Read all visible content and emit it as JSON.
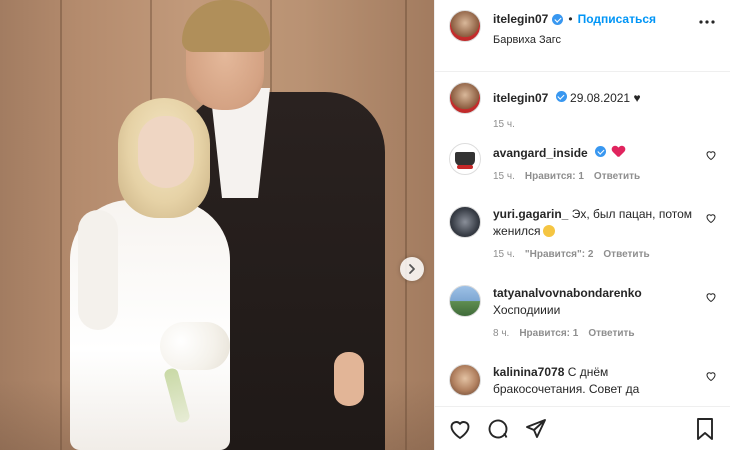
{
  "post": {
    "username": "itelegin07",
    "follow_label": "Подписаться",
    "separator": "•",
    "location": "Барвиха Загс"
  },
  "caption": {
    "username": "itelegin07",
    "text": "29.08.2021 ♥",
    "time": "15 ч."
  },
  "comments": [
    {
      "username": "avangard_inside",
      "text": "",
      "time": "15 ч.",
      "likes": "Нравится: 1",
      "reply": "Ответить",
      "avatar": "avangard-logo",
      "verified": true,
      "emoji": "heart"
    },
    {
      "username": "yuri.gagarin_",
      "text": "Эх, был пацан, потом женился",
      "time": "15 ч.",
      "likes": "\"Нравится\": 2",
      "reply": "Ответить",
      "avatar": "yuri-avatar",
      "emoji": "face-with-tears"
    },
    {
      "username": "tatyanalvovnabondarenko",
      "text": "Хосподииии",
      "time": "8 ч.",
      "likes": "Нравится: 1",
      "reply": "Ответить",
      "avatar": "tatyana-avatar"
    },
    {
      "username": "kalinina7078",
      "text": "С днём бракосочетания. Совет да",
      "time": "",
      "likes": "",
      "reply": "",
      "avatar": "kalinina-avatar"
    }
  ],
  "colors": {
    "accent": "#0095f6",
    "verified": "#3897f0",
    "heart": "#e0245e",
    "muted": "#8e8e8e",
    "text": "#262626"
  },
  "icons": {
    "more": "more-horizontal-icon",
    "like": "heart-icon",
    "comment": "comment-icon",
    "share": "paper-plane-icon",
    "save": "bookmark-icon",
    "next": "chevron-right-icon"
  }
}
